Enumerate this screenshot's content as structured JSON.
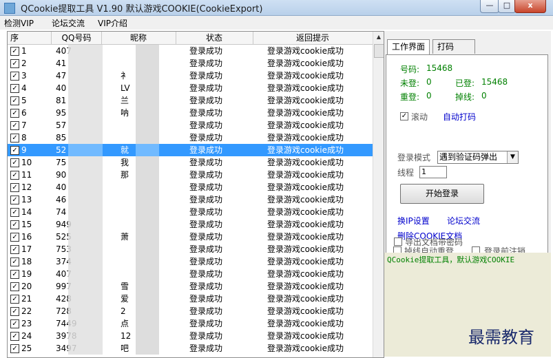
{
  "window": {
    "title": "QCookie提取工具 V1.90 默认游戏COOKIE(CookieExport)",
    "min_glyph": "—",
    "max_glyph": "□",
    "close_glyph": "x"
  },
  "menu": [
    "检测VIP",
    "论坛交流",
    "VIP介绍"
  ],
  "table": {
    "headers": [
      "序",
      "QQ号码",
      "昵称",
      "状态",
      "返回提示"
    ],
    "rows": [
      {
        "n": "1",
        "qq": "407",
        "nick": "",
        "status": "登录成功",
        "msg": "登录游戏cookie成功"
      },
      {
        "n": "2",
        "qq": "41",
        "nick": "",
        "status": "登录成功",
        "msg": "登录游戏cookie成功"
      },
      {
        "n": "3",
        "qq": "47",
        "nick": "衤",
        "status": "登录成功",
        "msg": "登录游戏cookie成功"
      },
      {
        "n": "4",
        "qq": "40",
        "nick": "LV",
        "status": "登录成功",
        "msg": "登录游戏cookie成功"
      },
      {
        "n": "5",
        "qq": "81",
        "nick": "兰",
        "status": "登录成功",
        "msg": "登录游戏cookie成功"
      },
      {
        "n": "6",
        "qq": "95",
        "nick": "呐",
        "status": "登录成功",
        "msg": "登录游戏cookie成功"
      },
      {
        "n": "7",
        "qq": "57",
        "nick": "",
        "status": "登录成功",
        "msg": "登录游戏cookie成功"
      },
      {
        "n": "8",
        "qq": "85",
        "nick": "",
        "status": "登录成功",
        "msg": "登录游戏cookie成功"
      },
      {
        "n": "9",
        "qq": "52",
        "nick": "就",
        "status": "登录成功",
        "msg": "登录游戏cookie成功"
      },
      {
        "n": "10",
        "qq": "75",
        "nick": "我",
        "status": "登录成功",
        "msg": "登录游戏cookie成功"
      },
      {
        "n": "11",
        "qq": "90",
        "nick": "那",
        "status": "登录成功",
        "msg": "登录游戏cookie成功"
      },
      {
        "n": "12",
        "qq": "40",
        "nick": "",
        "status": "登录成功",
        "msg": "登录游戏cookie成功"
      },
      {
        "n": "13",
        "qq": "46",
        "nick": "",
        "status": "登录成功",
        "msg": "登录游戏cookie成功"
      },
      {
        "n": "14",
        "qq": "74",
        "nick": "",
        "status": "登录成功",
        "msg": "登录游戏cookie成功"
      },
      {
        "n": "15",
        "qq": "949",
        "nick": "",
        "status": "登录成功",
        "msg": "登录游戏cookie成功"
      },
      {
        "n": "16",
        "qq": "525",
        "nick": "萧",
        "status": "登录成功",
        "msg": "登录游戏cookie成功"
      },
      {
        "n": "17",
        "qq": "753",
        "nick": "",
        "status": "登录成功",
        "msg": "登录游戏cookie成功"
      },
      {
        "n": "18",
        "qq": "374",
        "nick": "",
        "status": "登录成功",
        "msg": "登录游戏cookie成功"
      },
      {
        "n": "19",
        "qq": "407",
        "nick": "",
        "status": "登录成功",
        "msg": "登录游戏cookie成功"
      },
      {
        "n": "20",
        "qq": "997",
        "nick": "雪",
        "status": "登录成功",
        "msg": "登录游戏cookie成功"
      },
      {
        "n": "21",
        "qq": "428",
        "nick": "爱",
        "status": "登录成功",
        "msg": "登录游戏cookie成功"
      },
      {
        "n": "22",
        "qq": "728",
        "nick": "2",
        "status": "登录成功",
        "msg": "登录游戏cookie成功"
      },
      {
        "n": "23",
        "qq": "7449",
        "nick": "点",
        "status": "登录成功",
        "msg": "登录游戏cookie成功"
      },
      {
        "n": "24",
        "qq": "3978",
        "nick": "12",
        "status": "登录成功",
        "msg": "登录游戏cookie成功"
      },
      {
        "n": "25",
        "qq": "3497",
        "nick": "吧",
        "status": "登录成功",
        "msg": "登录游戏cookie成功"
      }
    ],
    "selected_index": 8,
    "check_glyph": "✓",
    "scroll_up_glyph": "▲"
  },
  "right": {
    "tabs": [
      "工作界面",
      "打码"
    ],
    "stats": {
      "haoma_label": "号码:",
      "haoma_value": "15468",
      "weideng_label": "未登:",
      "weideng_value": "0",
      "yideng_label": "已登:",
      "yideng_value": "15468",
      "chongdeng_label": "重登:",
      "chongdeng_value": "0",
      "diaoxian_label": "掉线:",
      "diaoxian_value": "0"
    },
    "scroll_label": "滚动",
    "scroll_checked": true,
    "auto_code_label": "自动打码",
    "login_mode_label": "登录模式",
    "login_mode_value": "遇到验证码弹出",
    "dropdown_glyph": "▼",
    "thread_label": "线程",
    "thread_value": "1",
    "start_button": "开始登录",
    "ip_link": "换IP设置",
    "forum_link": "论坛交流",
    "delete_link": "删除COOKIE文档",
    "opt_reconnect": "掉线自动重登",
    "opt_logout": "登录前注销",
    "opt_export_pwd": "导出文档带密码",
    "status_text": "QCookie提取工具，默认游戏COOKIE"
  },
  "watermark": "最需教育"
}
